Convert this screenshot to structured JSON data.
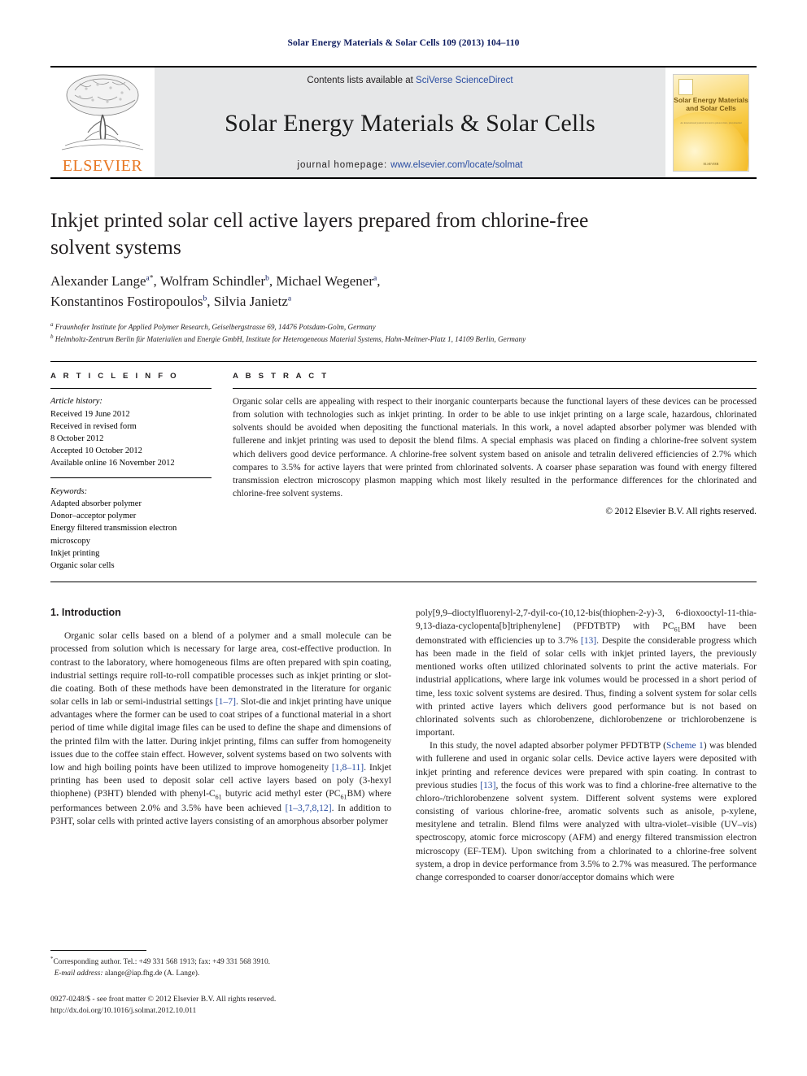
{
  "running_head": "Solar Energy Materials & Solar Cells 109 (2013) 104–110",
  "masthead": {
    "publisher_name": "ELSEVIER",
    "contents_prefix": "Contents lists available at ",
    "contents_link": "SciVerse ScienceDirect",
    "journal_title": "Solar Energy Materials & Solar Cells",
    "homepage_label": "journal homepage: ",
    "homepage_url": "www.elsevier.com/locate/solmat",
    "cover": {
      "title_line1": "Solar Energy Materials",
      "title_line2": "and Solar Cells",
      "subtitle": "An international journal devoted to photovoltaic, photothermal and photochemical solar energy conversion",
      "footer": "ELSEVIER"
    }
  },
  "article": {
    "title": "Inkjet printed solar cell active layers prepared from chlorine-free solvent systems",
    "authors": [
      {
        "name": "Alexander Lange",
        "sup": "a",
        "star": true,
        "sep": ", "
      },
      {
        "name": "Wolfram Schindler",
        "sup": "b",
        "star": false,
        "sep": ", "
      },
      {
        "name": "Michael Wegener",
        "sup": "a",
        "star": false,
        "sep": ","
      },
      {
        "name": "Konstantinos Fostiropoulos",
        "sup": "b",
        "star": false,
        "sep": ", "
      },
      {
        "name": "Silvia Janietz",
        "sup": "a",
        "star": false,
        "sep": ""
      }
    ],
    "affiliations": [
      {
        "mark": "a",
        "text": "Fraunhofer Institute for Applied Polymer Research, Geiselbergstrasse 69, 14476 Potsdam-Golm, Germany"
      },
      {
        "mark": "b",
        "text": "Helmholtz-Zentrum Berlin für Materialien und Energie GmbH, Institute for Heterogeneous Material Systems, Hahn-Meitner-Platz 1, 14109 Berlin, Germany"
      }
    ]
  },
  "article_info": {
    "heading": "A R T I C L E  I N F O",
    "history_label": "Article history:",
    "history": [
      "Received 19 June 2012",
      "Received in revised form",
      "8 October 2012",
      "Accepted 10 October 2012",
      "Available online 16 November 2012"
    ],
    "keywords_label": "Keywords:",
    "keywords": [
      "Adapted absorber polymer",
      "Donor–acceptor polymer",
      "Energy filtered transmission electron",
      "microscopy",
      "Inkjet printing",
      "Organic solar cells"
    ]
  },
  "abstract": {
    "heading": "A B S T R A C T",
    "text": "Organic solar cells are appealing with respect to their inorganic counterparts because the functional layers of these devices can be processed from solution with technologies such as inkjet printing. In order to be able to use inkjet printing on a large scale, hazardous, chlorinated solvents should be avoided when depositing the functional materials. In this work, a novel adapted absorber polymer was blended with fullerene and inkjet printing was used to deposit the blend films. A special emphasis was placed on finding a chlorine-free solvent system which delivers good device performance. A chlorine-free solvent system based on anisole and tetralin delivered efficiencies of 2.7% which compares to 3.5% for active layers that were printed from chlorinated solvents. A coarser phase separation was found with energy filtered transmission electron microscopy plasmon mapping which most likely resulted in the performance differences for the chlorinated and chlorine-free solvent systems.",
    "copyright": "© 2012 Elsevier B.V. All rights reserved."
  },
  "body": {
    "section_number_title": "1.  Introduction",
    "left_column": {
      "para1_a": "Organic solar cells based on a blend of a polymer and a small molecule can be processed from solution which is necessary for large area, cost-effective production. In contrast to the laboratory, where homogeneous films are often prepared with spin coating, industrial settings require roll-to-roll compatible processes such as inkjet printing or slot-die coating. Both of these methods have been demonstrated in the literature for organic solar cells in lab or semi-industrial settings ",
      "cite1": "[1–7]",
      "para1_b": ". Slot-die and inkjet printing have unique advantages where the former can be used to coat stripes of a functional material in a short period of time while digital image files can be used to define the shape and dimensions of the printed film with the latter. During inkjet printing, films can suffer from homogeneity issues due to the coffee stain effect. However, solvent systems based on two solvents with low and high boiling points have been utilized to improve homogeneity ",
      "cite2": "[1,8–11]",
      "para1_c": ". Inkjet printing has been used to deposit solar cell active layers based on poly (3-hexyl thiophene) (P3HT) blended with phenyl-C",
      "sub1": "61",
      "para1_d": " butyric acid methyl ester (PC",
      "sub2": "61",
      "para1_e": "BM) where performances between 2.0% and 3.5% have been achieved ",
      "cite3": "[1–3,7,8,12]",
      "para1_f": ". In addition to P3HT, solar cells with printed active layers consisting of an amorphous absorber polymer"
    },
    "right_column": {
      "para_cont_a": "poly[9,9–dioctylfluorenyl-2,7-dyil-co-(10,12-bis(thiophen-2-y)-3, 6-dioxooctyl-11-thia-9,13-diaza-cyclopenta[b]triphenylene] (PFDTBTP) with PC",
      "sub1": "61",
      "para_cont_b": "BM have been demonstrated with efficiencies up to 3.7% ",
      "cite1": "[13]",
      "para_cont_c": ". Despite the considerable progress which has been made in the field of solar cells with inkjet printed layers, the previously mentioned works often utilized chlorinated solvents to print the active materials. For industrial applications, where large ink volumes would be processed in a short period of time, less toxic solvent systems are desired. Thus, finding a solvent system for solar cells with printed active layers which delivers good performance but is not based on chlorinated solvents such as chlorobenzene, dichlorobenzene or trichlorobenzene is important.",
      "para2_a": "In this study, the novel adapted absorber polymer PFDTBTP (",
      "link_scheme": "Scheme 1",
      "para2_b": ") was blended with fullerene and used in organic solar cells. Device active layers were deposited with inkjet printing and reference devices were prepared with spin coating. In contrast to previous studies ",
      "cite2": "[13]",
      "para2_c": ", the focus of this work was to find a chlorine-free alternative to the chloro-/trichlorobenzene solvent system. Different solvent systems were explored consisting of various chlorine-free, aromatic solvents such as anisole, p-xylene, mesitylene and tetralin. Blend films were analyzed with ultra-violet–visible (UV–vis) spectroscopy, atomic force microscopy (AFM) and energy filtered transmission electron microscopy (EF-TEM). Upon switching from a chlorinated to a chlorine-free solvent system, a drop in device performance from 3.5% to 2.7% was measured. The performance change corresponded to coarser donor/acceptor domains which were"
    }
  },
  "footnote": {
    "marker": "*",
    "text": "Corresponding author. Tel.: +49 331 568 1913; fax: +49 331 568 3910.",
    "email_label": "E-mail address:",
    "email": "alange@iap.fhg.de (A. Lange)."
  },
  "colophon": {
    "line1": "0927-0248/$ - see front matter © 2012 Elsevier B.V. All rights reserved.",
    "line2": "http://dx.doi.org/10.1016/j.solmat.2012.10.011"
  },
  "colors": {
    "header_navy": "#0d1b5e",
    "link_blue": "#2b4ea2",
    "elsevier_orange": "#e87722",
    "banner_gray": "#e6e7e8"
  }
}
